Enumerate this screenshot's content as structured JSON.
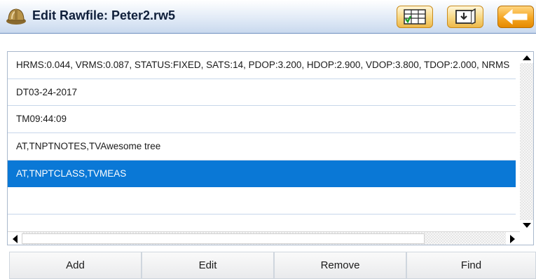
{
  "window": {
    "title": "Edit Rawfile: Peter2.rw5"
  },
  "toolbar": {
    "icons": [
      "hard-hat-icon",
      "table-check-icon",
      "import-icon",
      "back-arrow-icon"
    ],
    "accent": "#f5a623"
  },
  "list": {
    "selected_index": 4,
    "selected_color": "#0a78d6",
    "rows": [
      "HRMS:0.044, VRMS:0.087, STATUS:FIXED, SATS:14, PDOP:3.200, HDOP:2.900, VDOP:3.800, TDOP:2.000, NRMS",
      "DT03-24-2017",
      "TM09:44:09",
      "AT,TNPTNOTES,TVAwesome tree",
      "AT,TNPTCLASS,TVMEAS",
      ""
    ]
  },
  "buttons": {
    "add": "Add",
    "edit": "Edit",
    "remove": "Remove",
    "find": "Find"
  }
}
